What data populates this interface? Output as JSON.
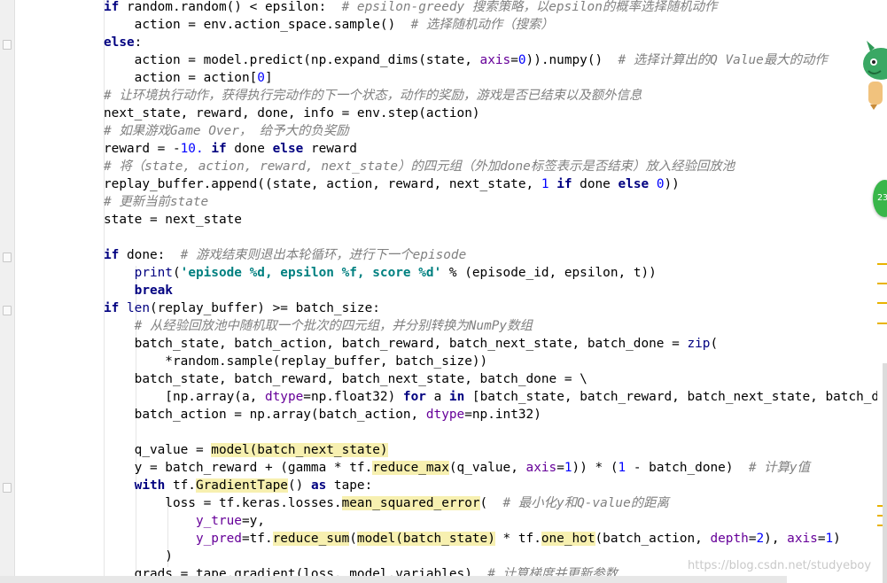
{
  "editor": {
    "lines": [
      [
        {
          "t": "if",
          "c": "kw"
        },
        {
          "t": " random.random() < epsilon:  "
        },
        {
          "t": "# epsilon-greedy 搜索策略，以epsilon的概率选择随机动作",
          "c": "cm"
        }
      ],
      [
        {
          "t": "    action = env.action_space.sample()  "
        },
        {
          "t": "# 选择随机动作（搜索）",
          "c": "cm"
        }
      ],
      [
        {
          "t": "else",
          "c": "kw"
        },
        {
          "t": ":"
        }
      ],
      [
        {
          "t": "    action = model.predict(np.expand_dims(state, "
        },
        {
          "t": "axis",
          "c": "arg"
        },
        {
          "t": "="
        },
        {
          "t": "0",
          "c": "num"
        },
        {
          "t": ")).numpy()  "
        },
        {
          "t": "# 选择计算出的Q Value最大的动作",
          "c": "cm"
        }
      ],
      [
        {
          "t": "    action = action["
        },
        {
          "t": "0",
          "c": "num"
        },
        {
          "t": "]"
        }
      ],
      [
        {
          "t": "# 让环境执行动作，获得执行完动作的下一个状态，动作的奖励，游戏是否已结束以及额外信息",
          "c": "cm"
        }
      ],
      [
        {
          "t": "next_state, reward, done, info = env.step(action)"
        }
      ],
      [
        {
          "t": "# 如果游戏Game Over， 给予大的负奖励",
          "c": "cm"
        }
      ],
      [
        {
          "t": "reward = -"
        },
        {
          "t": "10.",
          "c": "num"
        },
        {
          "t": " "
        },
        {
          "t": "if",
          "c": "kw"
        },
        {
          "t": " done "
        },
        {
          "t": "else",
          "c": "kw"
        },
        {
          "t": " reward"
        }
      ],
      [
        {
          "t": "# 将（state, action, reward, next_state）的四元组（外加done标签表示是否结束）放入经验回放池",
          "c": "cm"
        }
      ],
      [
        {
          "t": "replay_buffer.append((state, action, reward, next_state, "
        },
        {
          "t": "1",
          "c": "num"
        },
        {
          "t": " "
        },
        {
          "t": "if",
          "c": "kw"
        },
        {
          "t": " done "
        },
        {
          "t": "else",
          "c": "kw"
        },
        {
          "t": " "
        },
        {
          "t": "0",
          "c": "num"
        },
        {
          "t": "))"
        }
      ],
      [
        {
          "t": "# 更新当前state",
          "c": "cm"
        }
      ],
      [
        {
          "t": "state = next_state"
        }
      ],
      [],
      [
        {
          "t": "if",
          "c": "kw"
        },
        {
          "t": " done:  "
        },
        {
          "t": "# 游戏结束则退出本轮循环，进行下一个episode",
          "c": "cm"
        }
      ],
      [
        {
          "t": "    "
        },
        {
          "t": "print",
          "c": "bi"
        },
        {
          "t": "("
        },
        {
          "t": "'episode %d, epsilon %f, score %d'",
          "c": "str"
        },
        {
          "t": " % (episode_id, epsilon, t))"
        }
      ],
      [
        {
          "t": "    "
        },
        {
          "t": "break",
          "c": "kw"
        }
      ],
      [
        {
          "t": "if",
          "c": "kw"
        },
        {
          "t": " "
        },
        {
          "t": "len",
          "c": "bi"
        },
        {
          "t": "(replay_buffer) >= batch_size:"
        }
      ],
      [
        {
          "t": "    "
        },
        {
          "t": "# 从经验回放池中随机取一个批次的四元组，并分别转换为NumPy数组",
          "c": "cm"
        }
      ],
      [
        {
          "t": "    batch_state, batch_action, batch_reward, batch_next_state, batch_done = "
        },
        {
          "t": "zip",
          "c": "bi"
        },
        {
          "t": "("
        }
      ],
      [
        {
          "t": "        *random.sample(replay_buffer, batch_size))"
        }
      ],
      [
        {
          "t": "    batch_state, batch_reward, batch_next_state, batch_done = \\"
        }
      ],
      [
        {
          "t": "        [np.array(a, "
        },
        {
          "t": "dtype",
          "c": "arg"
        },
        {
          "t": "=np.float32) "
        },
        {
          "t": "for",
          "c": "kw"
        },
        {
          "t": " a "
        },
        {
          "t": "in",
          "c": "kw"
        },
        {
          "t": " [batch_state, batch_reward, batch_next_state, batch_done]]"
        }
      ],
      [
        {
          "t": "    batch_action = np.array(batch_action, "
        },
        {
          "t": "dtype",
          "c": "arg"
        },
        {
          "t": "=np.int32)"
        }
      ],
      [],
      [
        {
          "t": "    q_value = "
        },
        {
          "t": "model(batch_next_state)",
          "c": "hl"
        }
      ],
      [
        {
          "t": "    y = batch_reward + (gamma * tf."
        },
        {
          "t": "reduce_max",
          "c": "hl"
        },
        {
          "t": "(q_value, "
        },
        {
          "t": "axis",
          "c": "arg"
        },
        {
          "t": "="
        },
        {
          "t": "1",
          "c": "num"
        },
        {
          "t": ")) * ("
        },
        {
          "t": "1",
          "c": "num"
        },
        {
          "t": " - batch_done)  "
        },
        {
          "t": "# 计算y值",
          "c": "cm"
        }
      ],
      [
        {
          "t": "    "
        },
        {
          "t": "with",
          "c": "kw"
        },
        {
          "t": " tf."
        },
        {
          "t": "GradientTape",
          "c": "hl"
        },
        {
          "t": "() "
        },
        {
          "t": "as",
          "c": "kw"
        },
        {
          "t": " tape:"
        }
      ],
      [
        {
          "t": "        loss = tf.keras.losses."
        },
        {
          "t": "mean_squared_error",
          "c": "hl"
        },
        {
          "t": "(  "
        },
        {
          "t": "# 最小化y和Q-value的距离",
          "c": "cm"
        }
      ],
      [
        {
          "t": "            "
        },
        {
          "t": "y_true",
          "c": "arg"
        },
        {
          "t": "=y,"
        }
      ],
      [
        {
          "t": "            "
        },
        {
          "t": "y_pred",
          "c": "arg"
        },
        {
          "t": "=tf."
        },
        {
          "t": "reduce_sum",
          "c": "hl"
        },
        {
          "t": "("
        },
        {
          "t": "model(batch_state)",
          "c": "hl"
        },
        {
          "t": " * tf."
        },
        {
          "t": "one_hot",
          "c": "hl"
        },
        {
          "t": "(batch_action, "
        },
        {
          "t": "depth",
          "c": "arg"
        },
        {
          "t": "="
        },
        {
          "t": "2",
          "c": "num"
        },
        {
          "t": "), "
        },
        {
          "t": "axis",
          "c": "arg"
        },
        {
          "t": "="
        },
        {
          "t": "1",
          "c": "num"
        },
        {
          "t": ")"
        }
      ],
      [
        {
          "t": "        )"
        }
      ],
      [
        {
          "t": "    grads = tape.gradient(loss, model.variables)  "
        },
        {
          "t": "# 计算梯度并更新参数",
          "c": "cm"
        }
      ]
    ],
    "floating_badge": "23",
    "watermark": "https://blog.csdn.net/studyeboy"
  }
}
